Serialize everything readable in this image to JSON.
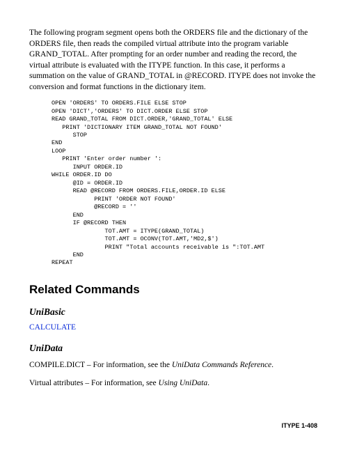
{
  "intro": "The following program segment opens both the ORDERS file and the dictionary of the ORDERS file, then reads the compiled virtual attribute into the program variable GRAND_TOTAL. After prompting for an order number and reading the record, the virtual attribute is evaluated with the ITYPE function. In this case, it performs a summation on the value of GRAND_TOTAL in @RECORD. ITYPE does not invoke the conversion and format functions in the dictionary item.",
  "code": "OPEN 'ORDERS' TO ORDERS.FILE ELSE STOP\nOPEN 'DICT','ORDERS' TO DICT.ORDER ELSE STOP\nREAD GRAND_TOTAL FROM DICT.ORDER,'GRAND_TOTAL' ELSE\n   PRINT 'DICTIONARY ITEM GRAND_TOTAL NOT FOUND'\n      STOP\nEND\nLOOP\n   PRINT 'Enter order number ':\n      INPUT ORDER.ID\nWHILE ORDER.ID DO\n      @ID = ORDER.ID\n      READ @RECORD FROM ORDERS.FILE,ORDER.ID ELSE\n            PRINT 'ORDER NOT FOUND'\n            @RECORD = ''\n      END\n      IF @RECORD THEN\n               TOT.AMT = ITYPE(GRAND_TOTAL)\n               TOT.AMT = OCONV(TOT.AMT,'MD2,$')\n               PRINT \"Total accounts receivable is \":TOT.AMT\n      END\nREPEAT",
  "related_heading": "Related Commands",
  "unibasic_heading": "UniBasic",
  "calculate_link": "CALCULATE",
  "unidata_heading": "UniData",
  "compile_text_a": "COMPILE.DICT – For information, see the ",
  "compile_text_em": "UniData Commands Reference",
  "compile_text_b": ".",
  "virtual_text_a": "Virtual attributes – For information, see ",
  "virtual_text_em": "Using UniData",
  "virtual_text_b": ".",
  "footer": "ITYPE  1-408"
}
